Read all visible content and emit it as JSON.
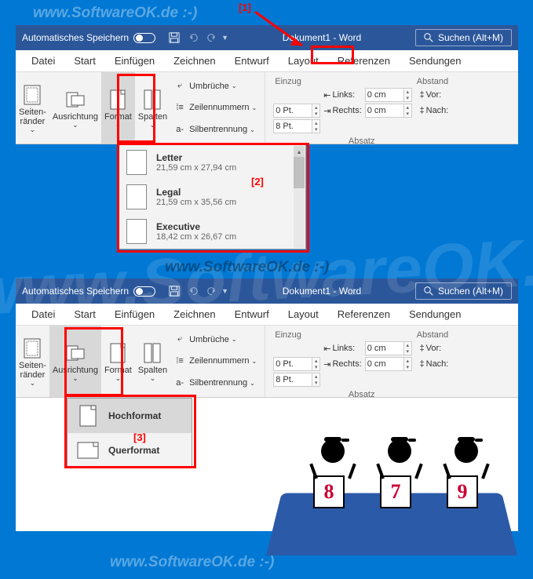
{
  "watermark": "www.SoftwareOK.de :-)",
  "annotations": {
    "n1": "[1]",
    "n2": "[2]",
    "n3": "[3]"
  },
  "titlebar": {
    "autosave": "Automatisches Speichern",
    "title": "Dokument1 - Word",
    "search": "Suchen (Alt+M)"
  },
  "menu": {
    "datei": "Datei",
    "start": "Start",
    "einfuegen": "Einfügen",
    "zeichnen": "Zeichnen",
    "entwurf": "Entwurf",
    "layout": "Layout",
    "referenzen": "Referenzen",
    "sendungen": "Sendungen"
  },
  "ribbon": {
    "seitenraender": "Seiten-\nränder",
    "ausrichtung": "Ausrichtung",
    "format": "Format",
    "spalten": "Spalten",
    "umbrueche": "Umbrüche",
    "zeilennummern": "Zeilennummern",
    "silbentrennung": "Silbentrennung",
    "einzug": "Einzug",
    "abstand": "Abstand",
    "links": "Links:",
    "rechts": "Rechts:",
    "vor": "Vor:",
    "nach": "Nach:",
    "val_links": "0 cm",
    "val_rechts": "0 cm",
    "val_vor": "0 Pt.",
    "val_nach": "8 Pt.",
    "absatz": "Absatz"
  },
  "format_dropdown": {
    "items": [
      {
        "title": "Letter",
        "sub": "21,59 cm x 27,94 cm"
      },
      {
        "title": "Legal",
        "sub": "21,59 cm x 35,56 cm"
      },
      {
        "title": "Executive",
        "sub": "18,42 cm x 26,67 cm"
      }
    ]
  },
  "orient_dropdown": {
    "items": [
      {
        "title": "Hochformat"
      },
      {
        "title": "Querformat"
      }
    ]
  },
  "judges": [
    "8",
    "7",
    "9"
  ]
}
